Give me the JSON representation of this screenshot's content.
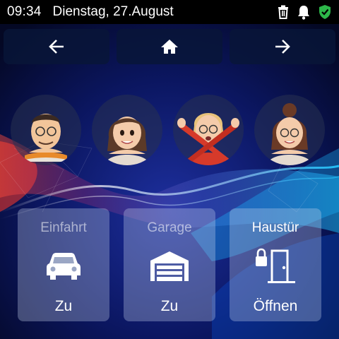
{
  "status_bar": {
    "time": "09:34",
    "date": "Dienstag, 27.August",
    "icons": [
      "trash-icon",
      "bell-icon",
      "shield-check-icon"
    ],
    "shield_color": "#2db84a"
  },
  "nav": {
    "icons": [
      "arrow-left-icon",
      "home-icon",
      "arrow-right-icon"
    ]
  },
  "people": [
    {
      "name": "avatar-man-glasses"
    },
    {
      "name": "avatar-woman-brown-hair"
    },
    {
      "name": "avatar-woman-crossed-arms"
    },
    {
      "name": "avatar-woman-bun"
    }
  ],
  "tiles": [
    {
      "title": "Einfahrt",
      "state": "Zu",
      "icon": "car-icon"
    },
    {
      "title": "Garage",
      "state": "Zu",
      "icon": "garage-icon"
    },
    {
      "title": "Haustür",
      "state": "Öffnen",
      "icon": "door-lock-icon"
    }
  ]
}
